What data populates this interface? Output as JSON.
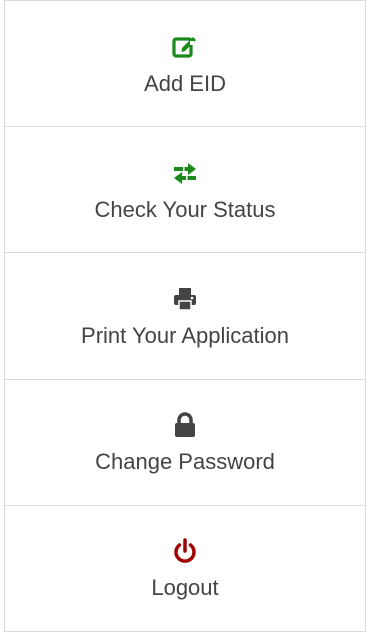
{
  "menu": {
    "items": [
      {
        "label": "Add EID",
        "icon": "edit-icon",
        "color": "#1a8a1a"
      },
      {
        "label": "Check Your Status",
        "icon": "exchange-icon",
        "color": "#1a8a1a"
      },
      {
        "label": "Print Your Application",
        "icon": "print-icon",
        "color": "#444444"
      },
      {
        "label": "Change Password",
        "icon": "lock-icon",
        "color": "#444444"
      },
      {
        "label": "Logout",
        "icon": "power-icon",
        "color": "#a00000"
      }
    ]
  }
}
